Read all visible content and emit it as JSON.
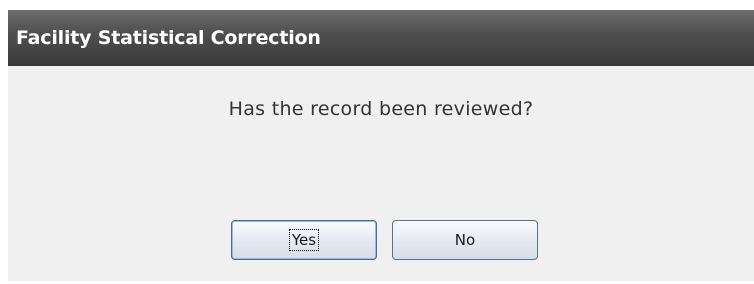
{
  "dialog": {
    "title": "Facility Statistical Correction",
    "message": "Has the record been reviewed?",
    "buttons": {
      "yes_label": "Yes",
      "no_label": "No"
    }
  }
}
